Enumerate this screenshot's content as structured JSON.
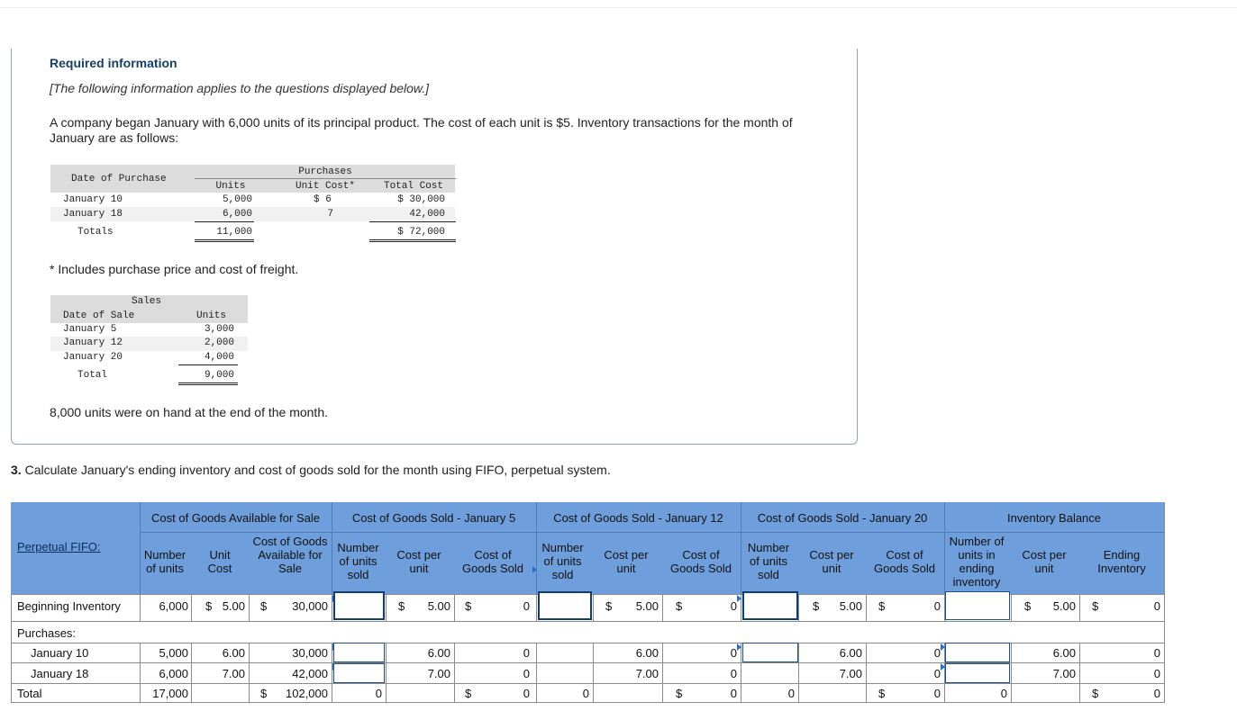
{
  "intro": {
    "title": "Required information",
    "subtitle": "[The following information applies to the questions displayed below.]",
    "paragraph": "A company began January with 6,000 units of its principal product. The cost of each unit is $5. Inventory transactions for the month of January are as follows:",
    "footnote": "* Includes purchase price and cost of freight.",
    "on_hand": "8,000 units were on hand at the end of the month."
  },
  "purchases": {
    "group_header": "Purchases",
    "col_date": "Date of Purchase",
    "col_units": "Units",
    "col_unit_cost": "Unit Cost*",
    "col_total": "Total Cost",
    "rows": [
      {
        "date": "January 10",
        "units": "5,000",
        "unit_cost": "$ 6",
        "total": "$ 30,000"
      },
      {
        "date": "January 18",
        "units": "6,000",
        "unit_cost": "7",
        "total": "42,000"
      }
    ],
    "totals": {
      "label": "Totals",
      "units": "11,000",
      "total": "$ 72,000"
    }
  },
  "sales": {
    "group_header": "Sales",
    "col_date": "Date of Sale",
    "col_units": "Units",
    "rows": [
      {
        "date": "January 5",
        "units": "3,000"
      },
      {
        "date": "January 12",
        "units": "2,000"
      },
      {
        "date": "January 20",
        "units": "4,000"
      }
    ],
    "total": {
      "label": "Total",
      "units": "9,000"
    }
  },
  "question": {
    "number": "3.",
    "text": " Calculate January's ending inventory and cost of goods sold for the month using FIFO, perpetual system."
  },
  "worksheet": {
    "title_link": "Perpetual FIFO:",
    "groups": {
      "available": "Cost of Goods Available for Sale",
      "jan5": "Cost of Goods Sold - January 5",
      "jan12": "Cost of Goods Sold - January 12",
      "jan20": "Cost of Goods Sold - January 20",
      "balance": "Inventory Balance"
    },
    "sub": {
      "num_units": "Number of units",
      "unit_cost": "Unit Cost",
      "cogas": "Cost of Goods Available for Sale",
      "num_sold": "Number of units sold",
      "cost_per_unit": "Cost per unit",
      "cogs": "Cost of Goods Sold",
      "num_ending": "Number of units in ending inventory",
      "ending_inv": "Ending Inventory"
    },
    "row_labels": {
      "beginning": "Beginning Inventory",
      "purchases": "Purchases:",
      "jan10": "January 10",
      "jan18": "January 18",
      "total": "Total"
    },
    "currency": "$",
    "avail": {
      "beg": {
        "units": "6,000",
        "cost": "5.00",
        "total": "30,000"
      },
      "jan10": {
        "units": "5,000",
        "cost": "6.00",
        "total": "30,000"
      },
      "jan18": {
        "units": "6,000",
        "cost": "7.00",
        "total": "42,000"
      },
      "total": {
        "units": "17,000",
        "total": "102,000"
      }
    },
    "cpu": {
      "beg": "5.00",
      "jan10": "6.00",
      "jan18": "7.00"
    },
    "zero": "0"
  }
}
